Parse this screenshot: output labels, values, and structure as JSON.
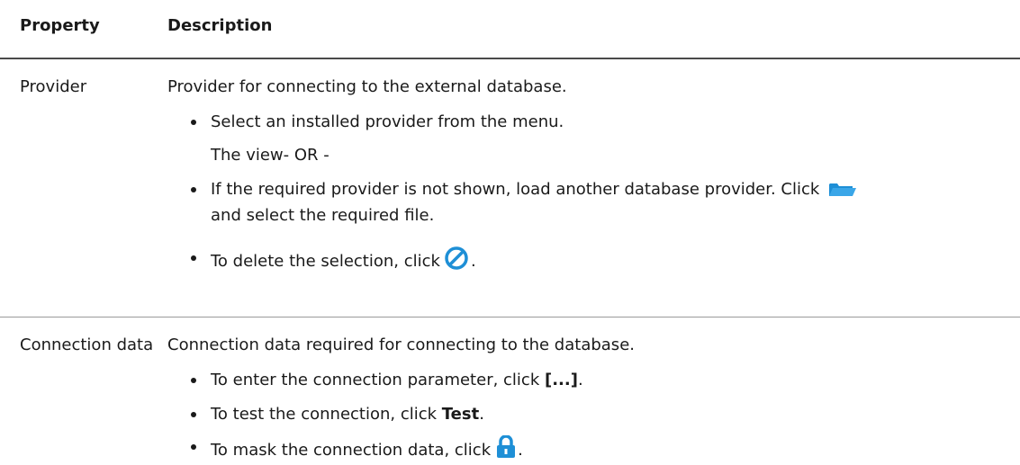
{
  "header": {
    "col_property": "Property",
    "col_description": "Description"
  },
  "rows": [
    {
      "property": "Provider",
      "description": "Provider for connecting to the external database.",
      "bullet1": "Select an installed provider from the menu.",
      "plain": "The view- OR -",
      "bullet2a": "If the required provider is not shown, load another database provider. Click",
      "bullet2b": "and select the required file.",
      "bullet3a": "To delete the selection, click",
      "bullet3b": "."
    },
    {
      "property": "Connection data",
      "description": "Connection data required for connecting to the database.",
      "bullet1a": "To enter the connection parameter, click ",
      "bullet1bold": "[...]",
      "bullet1b": ".",
      "bullet2a": "To test the connection, click ",
      "bullet2bold": "Test",
      "bullet2b": ".",
      "bullet3a": "To mask the connection data, click",
      "bullet3b": "."
    }
  ],
  "icons": {
    "folder": "folder-open-icon",
    "delete": "no-entry-icon",
    "lock": "lock-icon"
  },
  "colors": {
    "icon_blue": "#1e8fd6"
  }
}
